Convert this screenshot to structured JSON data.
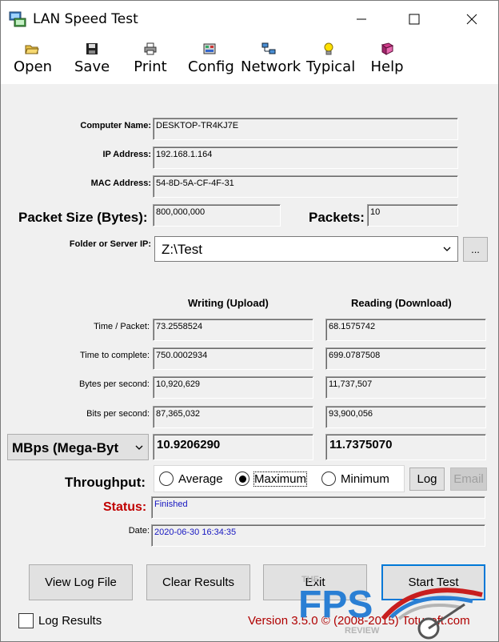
{
  "window": {
    "title": "LAN Speed Test"
  },
  "toolbar": {
    "items": [
      {
        "label": "Open",
        "icon": "folder-open-icon"
      },
      {
        "label": "Save",
        "icon": "floppy-disk-icon"
      },
      {
        "label": "Print",
        "icon": "printer-icon"
      },
      {
        "label": "Config",
        "icon": "config-icon"
      },
      {
        "label": "Network",
        "icon": "network-icon"
      },
      {
        "label": "Typical",
        "icon": "lightbulb-icon"
      },
      {
        "label": "Help",
        "icon": "help-book-icon"
      }
    ]
  },
  "info": {
    "computer_name_label": "Computer Name:",
    "computer_name": "DESKTOP-TR4KJ7E",
    "ip_label": "IP Address:",
    "ip": "192.168.1.164",
    "mac_label": "MAC Address:",
    "mac": "54-8D-5A-CF-4F-31",
    "packet_size_label": "Packet Size (Bytes):",
    "packet_size": "800,000,000",
    "packets_label": "Packets:",
    "packets": "10",
    "folder_label": "Folder or Server IP:",
    "folder": "Z:\\Test",
    "browse": "..."
  },
  "results": {
    "writing_header": "Writing (Upload)",
    "reading_header": "Reading (Download)",
    "rows": [
      {
        "label": "Time / Packet:",
        "write": "73.2558524",
        "read": "68.1575742"
      },
      {
        "label": "Time to complete:",
        "write": "750.0002934",
        "read": "699.0787508"
      },
      {
        "label": "Bytes per second:",
        "write": "10,920,629",
        "read": "11,737,507"
      },
      {
        "label": "Bits per second:",
        "write": "87,365,032",
        "read": "93,900,056"
      }
    ],
    "units": "MBps (Mega-Byt",
    "write_units_value": "10.9206290",
    "read_units_value": "11.7375070"
  },
  "throughput": {
    "label": "Throughput:",
    "options": [
      "Average",
      "Maximum",
      "Minimum"
    ],
    "selected": "Maximum",
    "log_button": "Log",
    "email_button": "Email"
  },
  "status": {
    "label": "Status:",
    "value": "Finished",
    "date_label": "Date:",
    "date": "2020-06-30 16:34:35"
  },
  "actions": {
    "view_log": "View Log File",
    "clear_results": "Clear Results",
    "exit": "Exit",
    "start_test": "Start Test",
    "log_results": "Log Results",
    "log_results_checked": false
  },
  "footer": {
    "version": "Version 3.5.0  © (2008-2015) Totusoft.com"
  },
  "watermark": {
    "top": "THE",
    "main": "FPS",
    "bottom": "REVIEW"
  },
  "colors": {
    "status_label": "#c00000",
    "link_blue": "#1515c0",
    "default_button_border": "#0078d7",
    "watermark_blue": "#2a7fd4"
  }
}
